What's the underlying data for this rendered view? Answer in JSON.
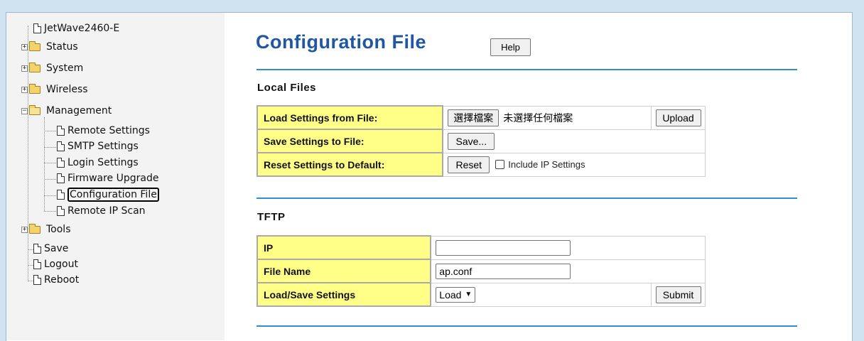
{
  "sidebar": {
    "device": "JetWave2460-E",
    "status": "Status",
    "system": "System",
    "wireless": "Wireless",
    "management": "Management",
    "management_children": [
      "Remote Settings",
      "SMTP Settings",
      "Login Settings",
      "Firmware Upgrade",
      "Configuration File",
      "Remote IP Scan"
    ],
    "tools": "Tools",
    "save": "Save",
    "logout": "Logout",
    "reboot": "Reboot"
  },
  "page": {
    "title": "Configuration File",
    "help_label": "Help"
  },
  "local_files": {
    "title": "Local Files",
    "load_label": "Load Settings from File:",
    "choose_file_label": "選擇檔案",
    "no_file_text": "未選擇任何檔案",
    "upload_label": "Upload",
    "save_label": "Save Settings to File:",
    "save_button": "Save...",
    "reset_label": "Reset Settings to Default:",
    "reset_button": "Reset",
    "include_ip_label": "Include IP Settings"
  },
  "tftp": {
    "title": "TFTP",
    "ip_label": "IP",
    "ip_value": "",
    "file_name_label": "File Name",
    "file_name_value": "ap.conf",
    "load_save_label": "Load/Save Settings",
    "load_save_selected": "Load",
    "submit_label": "Submit"
  }
}
